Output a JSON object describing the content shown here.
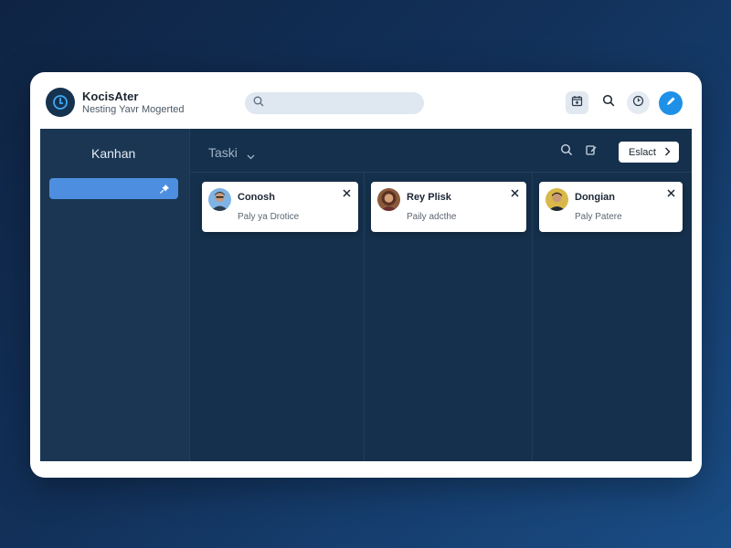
{
  "header": {
    "title": "KocisAter",
    "subtitle": "Nesting Yavr Mogerted",
    "search": {
      "placeholder": "",
      "value": ""
    },
    "icons": [
      "calendar-icon",
      "search-icon",
      "clock-icon",
      "edit-icon"
    ]
  },
  "sidebar": {
    "title": "Kanhan",
    "active_item": {
      "label": "",
      "icon": "pin-icon"
    }
  },
  "toolbar": {
    "tasks_label": "Taski",
    "select_label": "Eslact"
  },
  "cards": [
    {
      "name": "Conosh",
      "sub": "Paly ya Drotice"
    },
    {
      "name": "Rey Plisk",
      "sub": "Paily adcthe"
    },
    {
      "name": "Dongian",
      "sub": "Paly Patere"
    }
  ],
  "colors": {
    "accent": "#1e90e8",
    "board_bg": "#15304c",
    "sidebar_active": "#4d8ee0"
  }
}
